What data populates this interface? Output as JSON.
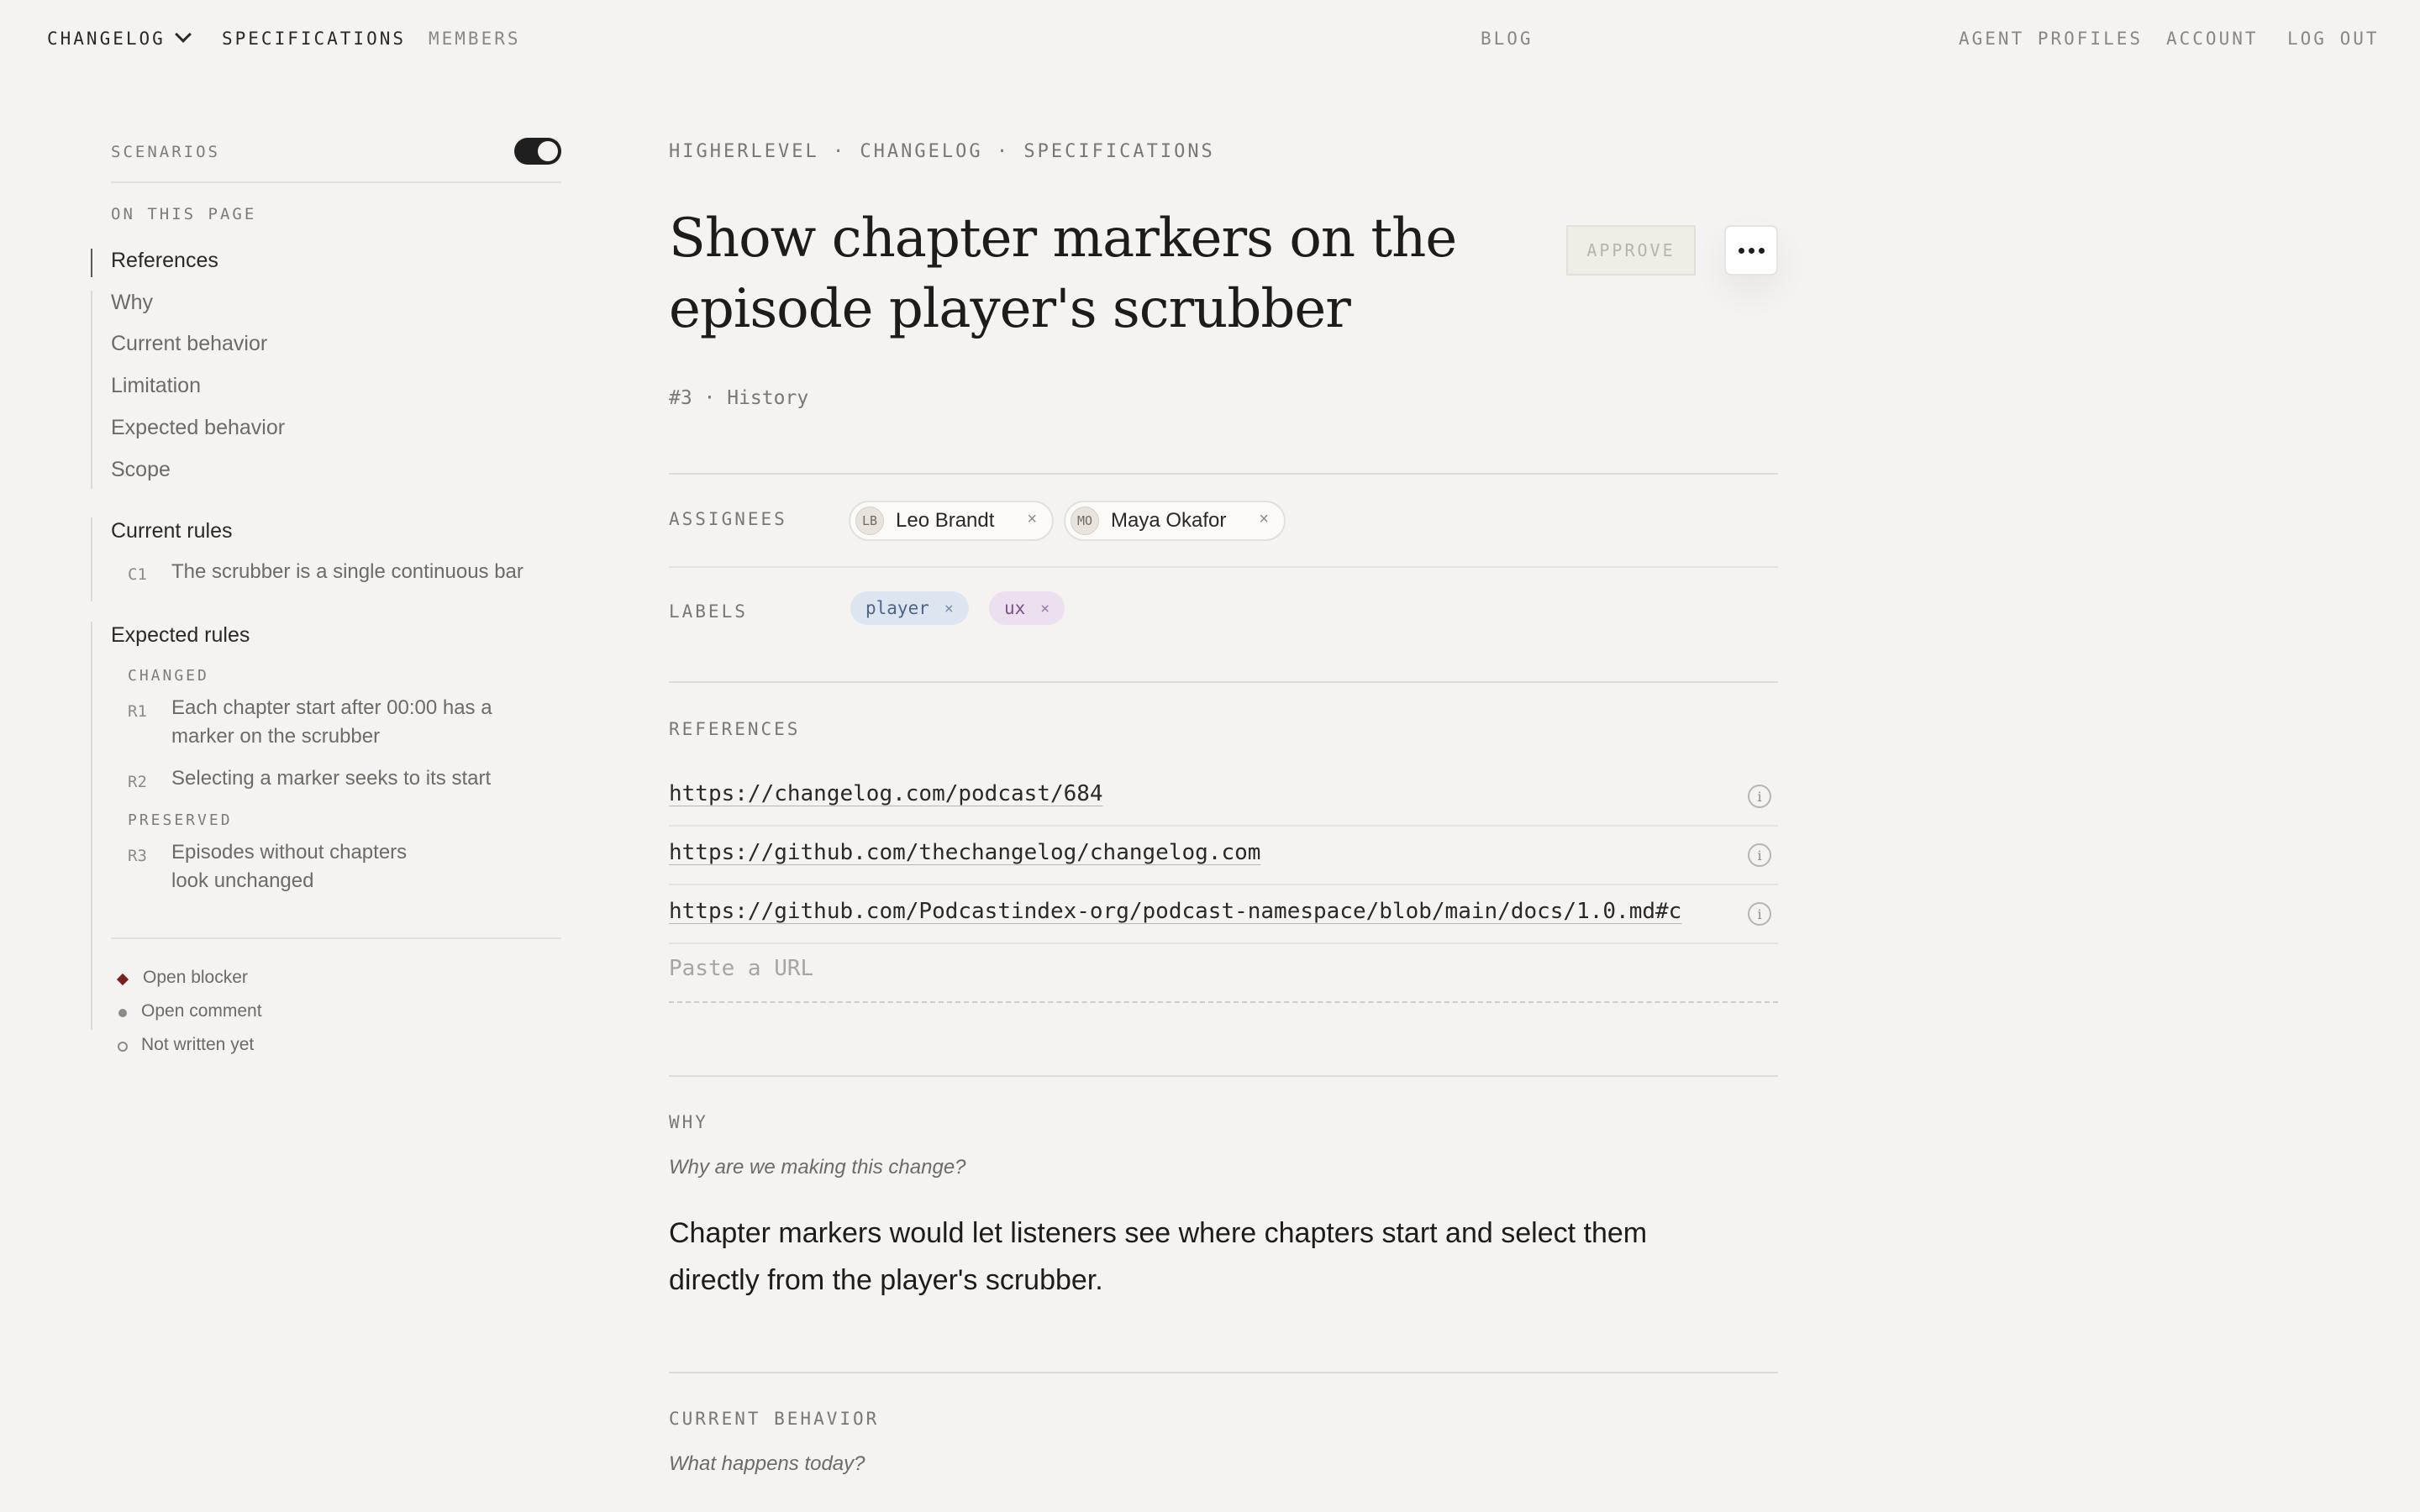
{
  "nav": {
    "left": [
      {
        "label": "CHANGELOG"
      },
      {
        "label": "SPECIFICATIONS"
      },
      {
        "label": "MEMBERS"
      }
    ],
    "center": "BLOG",
    "right": [
      {
        "label": "AGENT PROFILES"
      },
      {
        "label": "ACCOUNT"
      },
      {
        "label": "LOG OUT"
      }
    ]
  },
  "sidebar": {
    "scenarios_label": "SCENARIOS",
    "scenarios_on": true,
    "on_this_page": "ON THIS PAGE",
    "toc": [
      {
        "label": "References",
        "active": true
      },
      {
        "label": "Why"
      },
      {
        "label": "Current behavior"
      },
      {
        "label": "Limitation"
      },
      {
        "label": "Expected behavior"
      },
      {
        "label": "Scope"
      }
    ],
    "current_rules": {
      "heading": "Current rules",
      "items": [
        {
          "code": "C1",
          "text": "The scrubber is a single continuous bar"
        }
      ]
    },
    "expected_rules": {
      "heading": "Expected rules",
      "changed_label": "CHANGED",
      "changed": [
        {
          "code": "R1",
          "text": "Each chapter start after 00:00 has a marker on the scrubber"
        },
        {
          "code": "R2",
          "text": "Selecting a marker seeks to its start"
        }
      ],
      "preserved_label": "PRESERVED",
      "preserved": [
        {
          "code": "R3",
          "text": "Episodes without chapters look unchanged"
        }
      ]
    },
    "legend": [
      {
        "label": "Open blocker",
        "color": "#7a1f1f"
      },
      {
        "label": "Open comment",
        "color": "#8d8983"
      },
      {
        "label": "Not written yet",
        "color": "#8d8983"
      }
    ]
  },
  "main": {
    "breadcrumb": "HIGHERLEVEL · CHANGELOG · SPECIFICATIONS",
    "title": "Show chapter markers on the episode player's scrubber",
    "approve_label": "APPROVE",
    "meta": "#3 · History",
    "assignees_label": "ASSIGNEES",
    "assignees": [
      {
        "initials": "LB",
        "name": "Leo Brandt"
      },
      {
        "initials": "MO",
        "name": "Maya Okafor"
      }
    ],
    "labels_label": "LABELS",
    "labels": [
      {
        "name": "player",
        "bg": "#dde5f0",
        "fg": "#4c6587"
      },
      {
        "name": "ux",
        "bg": "#ebdff0",
        "fg": "#7b4f88"
      }
    ],
    "references_label": "REFERENCES",
    "references": [
      "https://changelog.com/podcast/684",
      "https://github.com/thechangelog/changelog.com",
      "https://github.com/Podcastindex-org/podcast-namespace/blob/main/docs/1.0.md#c"
    ],
    "paste_placeholder": "Paste a URL",
    "why": {
      "heading": "WHY",
      "prompt": "Why are we making this change?",
      "body": "Chapter markers would let listeners see where chapters start and select them directly from the player's scrubber."
    },
    "current_behavior": {
      "heading": "CURRENT BEHAVIOR",
      "prompt": "What happens today?"
    }
  }
}
